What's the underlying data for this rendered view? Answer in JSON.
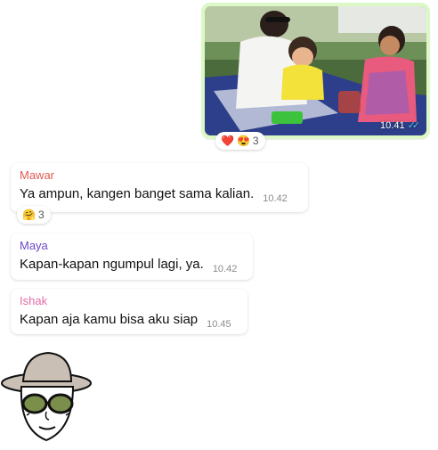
{
  "colors": {
    "outgoing_bubble": "#dcf8c6",
    "incoming_bubble": "#ffffff",
    "mawar": "#e05a54",
    "maya": "#6b48c9",
    "ishak": "#e36ba8",
    "read_ticks": "#53bdeb"
  },
  "photo_message": {
    "time": "10.41",
    "status": "read",
    "reactions": {
      "emojis": [
        "❤️",
        "😍"
      ],
      "count": "3"
    }
  },
  "messages": [
    {
      "sender": "Mawar",
      "text": "Ya ampun, kangen banget sama kalian.",
      "time": "10.42",
      "reaction": {
        "emoji": "🤗",
        "count": "3"
      }
    },
    {
      "sender": "Maya",
      "text": "Kapan-kapan ngumpul lagi, ya.",
      "time": "10.42"
    },
    {
      "sender": "Ishak",
      "text": "Kapan aja kamu bisa aku siap",
      "time": "10.45"
    }
  ],
  "sticker": {
    "icon": "woman-with-hat-sunglasses-icon"
  }
}
